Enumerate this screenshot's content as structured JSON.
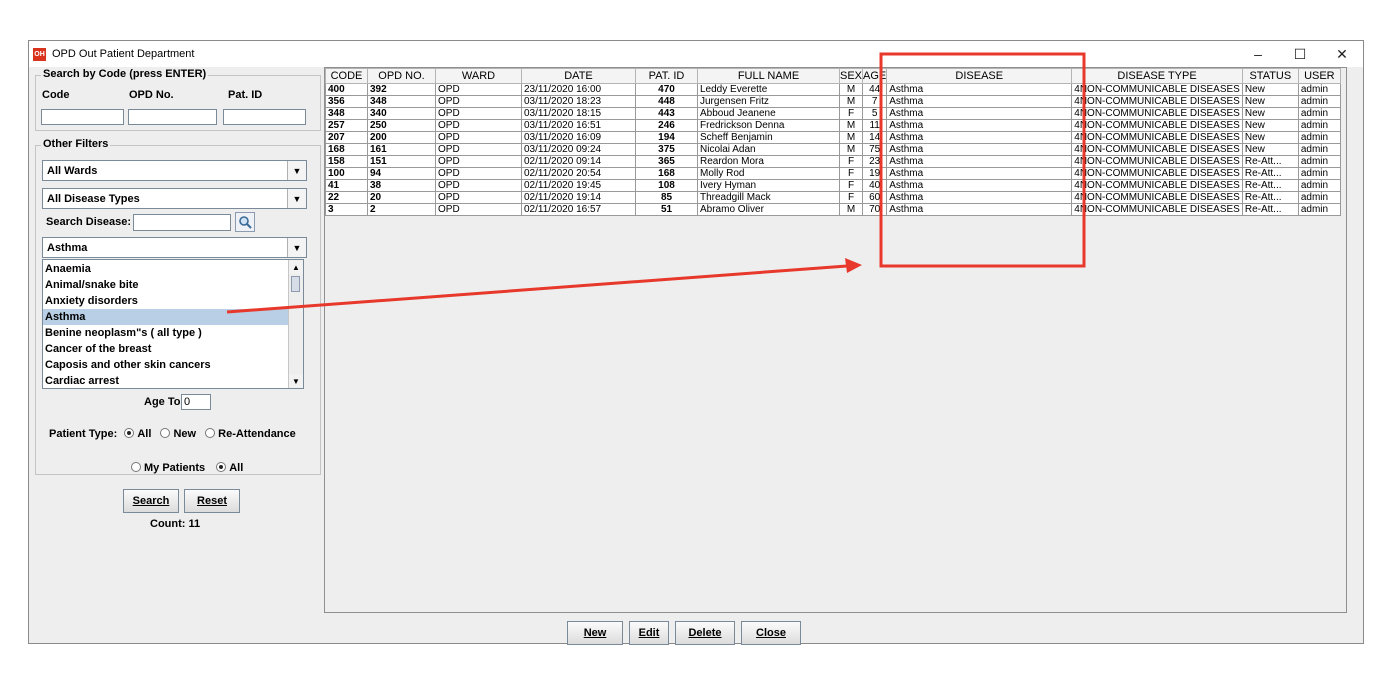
{
  "window": {
    "title": "OPD Out Patient Department",
    "icon_text": "OH",
    "minimize": "–",
    "maximize": "☐",
    "close": "✕"
  },
  "search_code": {
    "legend": "Search by Code (press ENTER)",
    "code_label": "Code",
    "opd_label": "OPD No.",
    "patid_label": "Pat. ID",
    "code_value": "",
    "opd_value": "",
    "patid_value": ""
  },
  "filters": {
    "legend": "Other Filters",
    "ward": "All Wards",
    "disease_type": "All Disease Types",
    "search_disease_label": "Search Disease:",
    "search_disease_value": "",
    "disease_selected": "Asthma",
    "disease_options": [
      "Anaemia",
      "Animal/snake bite",
      "Anxiety disorders",
      "Asthma",
      "Benine neoplasm\"s ( all type )",
      "Cancer of the breast",
      "Caposis and other skin cancers",
      "Cardiac arrest"
    ],
    "age_to_label": "Age To:",
    "age_to_value": "0",
    "patient_type_label": "Patient Type:",
    "pt_all": "All",
    "pt_new": "New",
    "pt_re": "Re-Attendance",
    "my_patients": "My Patients",
    "all": "All"
  },
  "actions": {
    "search": "Search",
    "reset": "Reset",
    "count_label": "Count: 11"
  },
  "table": {
    "columns": [
      "CODE",
      "OPD NO.",
      "WARD",
      "DATE",
      "PAT. ID",
      "FULL NAME",
      "SEX",
      "AGE",
      "DISEASE",
      "DISEASE TYPE",
      "STATUS",
      "USER"
    ],
    "rows": [
      [
        "400",
        "392",
        "OPD",
        "23/11/2020 16:00",
        "470",
        "Leddy Everette",
        "M",
        "44",
        "Asthma",
        "4",
        "NON-COMMUNICABLE DISEASES",
        "New",
        "admin"
      ],
      [
        "356",
        "348",
        "OPD",
        "03/11/2020 18:23",
        "448",
        "Jurgensen Fritz",
        "M",
        "7",
        "Asthma",
        "4",
        "NON-COMMUNICABLE DISEASES",
        "New",
        "admin"
      ],
      [
        "348",
        "340",
        "OPD",
        "03/11/2020 18:15",
        "443",
        "Abboud Jeanene",
        "F",
        "5",
        "Asthma",
        "4",
        "NON-COMMUNICABLE DISEASES",
        "New",
        "admin"
      ],
      [
        "257",
        "250",
        "OPD",
        "03/11/2020 16:51",
        "246",
        "Fredrickson Denna",
        "M",
        "11",
        "Asthma",
        "4",
        "NON-COMMUNICABLE DISEASES",
        "New",
        "admin"
      ],
      [
        "207",
        "200",
        "OPD",
        "03/11/2020 16:09",
        "194",
        "Scheff Benjamin",
        "M",
        "14",
        "Asthma",
        "4",
        "NON-COMMUNICABLE DISEASES",
        "New",
        "admin"
      ],
      [
        "168",
        "161",
        "OPD",
        "03/11/2020 09:24",
        "375",
        "Nicolai Adan",
        "M",
        "75",
        "Asthma",
        "4",
        "NON-COMMUNICABLE DISEASES",
        "New",
        "admin"
      ],
      [
        "158",
        "151",
        "OPD",
        "02/11/2020 09:14",
        "365",
        "Reardon Mora",
        "F",
        "23",
        "Asthma",
        "4",
        "NON-COMMUNICABLE DISEASES",
        "Re-Att...",
        "admin"
      ],
      [
        "100",
        "94",
        "OPD",
        "02/11/2020 20:54",
        "168",
        "Molly Rod",
        "F",
        "19",
        "Asthma",
        "4",
        "NON-COMMUNICABLE DISEASES",
        "Re-Att...",
        "admin"
      ],
      [
        "41",
        "38",
        "OPD",
        "02/11/2020 19:45",
        "108",
        "Ivery Hyman",
        "F",
        "40",
        "Asthma",
        "4",
        "NON-COMMUNICABLE DISEASES",
        "Re-Att...",
        "admin"
      ],
      [
        "22",
        "20",
        "OPD",
        "02/11/2020 19:14",
        "85",
        "Threadgill Mack",
        "F",
        "60",
        "Asthma",
        "4",
        "NON-COMMUNICABLE DISEASES",
        "Re-Att...",
        "admin"
      ],
      [
        "3",
        "2",
        "OPD",
        "02/11/2020 16:57",
        "51",
        "Abramo Oliver",
        "M",
        "70",
        "Asthma",
        "4",
        "NON-COMMUNICABLE DISEASES",
        "Re-Att...",
        "admin"
      ]
    ]
  },
  "buttons": {
    "new": "New",
    "edit": "Edit",
    "delete": "Delete",
    "close": "Close"
  },
  "colors": {
    "annotation": "#e8382b",
    "selection": "#b8cfe5",
    "app_icon": "#d9331d"
  }
}
